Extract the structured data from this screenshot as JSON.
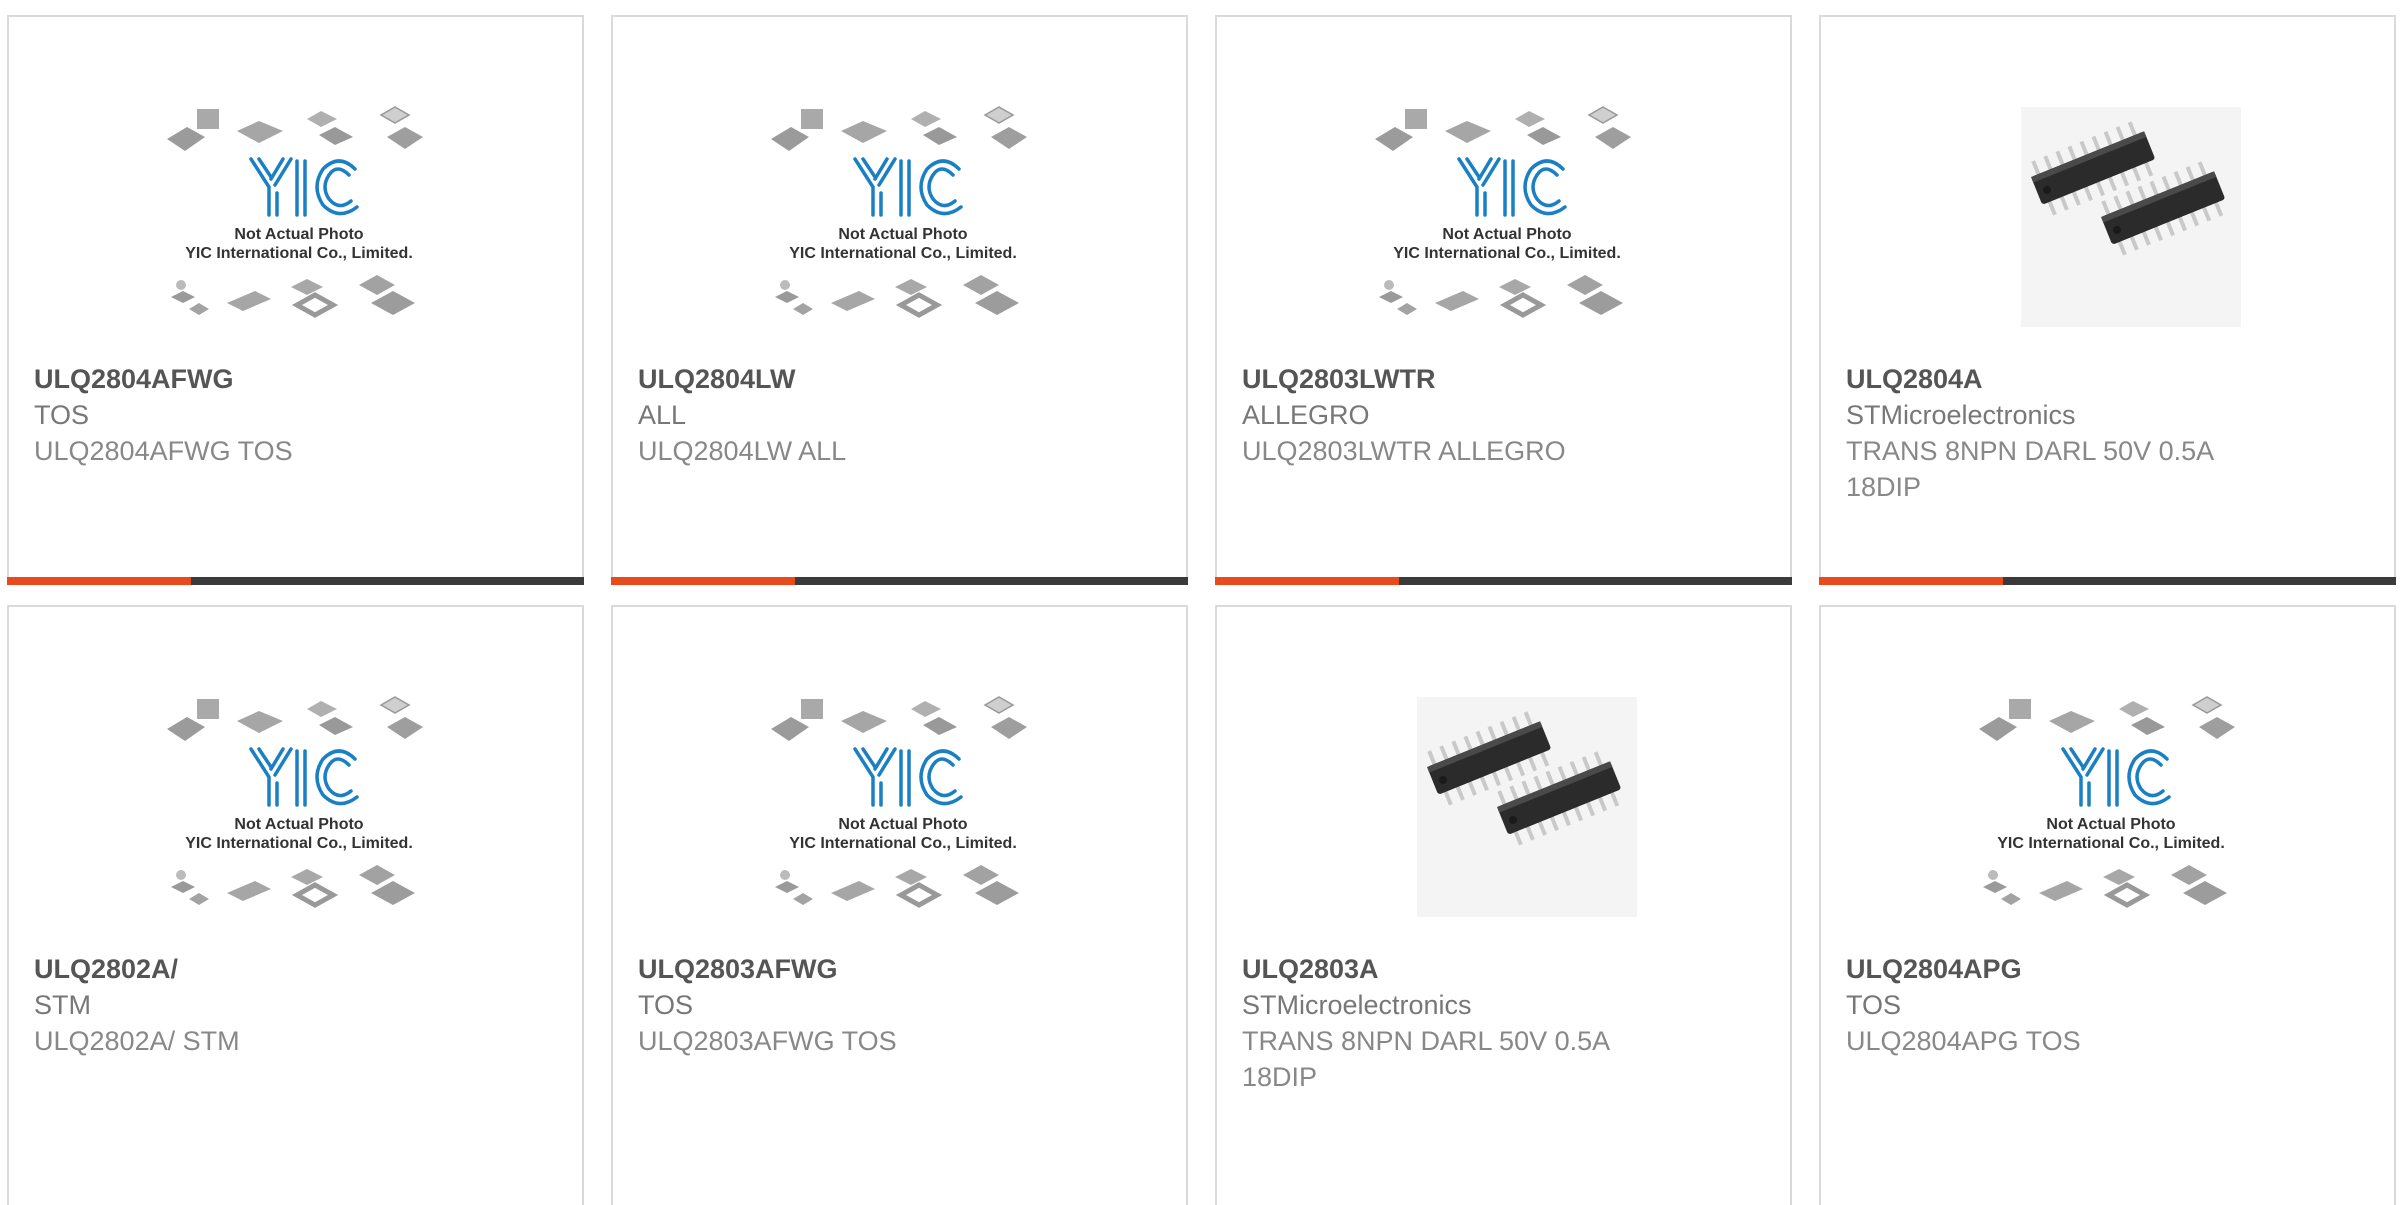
{
  "placeholder": {
    "watermark_line1": "Not Actual Photo",
    "watermark_line2": "YIC International Co., Limited."
  },
  "colors": {
    "accent": "#e84a1c",
    "bar_dark": "#3a3a3a",
    "logo_blue": "#1a7fc3"
  },
  "products": [
    {
      "part": "ULQ2804AFWG",
      "mfr": "TOS",
      "desc": "ULQ2804AFWG TOS",
      "image": "placeholder"
    },
    {
      "part": "ULQ2804LW",
      "mfr": "ALL",
      "desc": "ULQ2804LW ALL",
      "image": "placeholder"
    },
    {
      "part": "ULQ2803LWTR",
      "mfr": "ALLEGRO",
      "desc": "ULQ2803LWTR ALLEGRO",
      "image": "placeholder"
    },
    {
      "part": "ULQ2804A",
      "mfr": "STMicroelectronics",
      "desc": "TRANS 8NPN DARL 50V 0.5A\n18DIP",
      "image": "dip-chip"
    },
    {
      "part": "ULQ2802A/",
      "mfr": "STM",
      "desc": "ULQ2802A/ STM",
      "image": "placeholder"
    },
    {
      "part": "ULQ2803AFWG",
      "mfr": "TOS",
      "desc": "ULQ2803AFWG TOS",
      "image": "placeholder"
    },
    {
      "part": "ULQ2803A",
      "mfr": "STMicroelectronics",
      "desc": "TRANS 8NPN DARL 50V 0.5A\n18DIP",
      "image": "dip-chip"
    },
    {
      "part": "ULQ2804APG",
      "mfr": "TOS",
      "desc": "ULQ2804APG TOS",
      "image": "placeholder"
    }
  ]
}
